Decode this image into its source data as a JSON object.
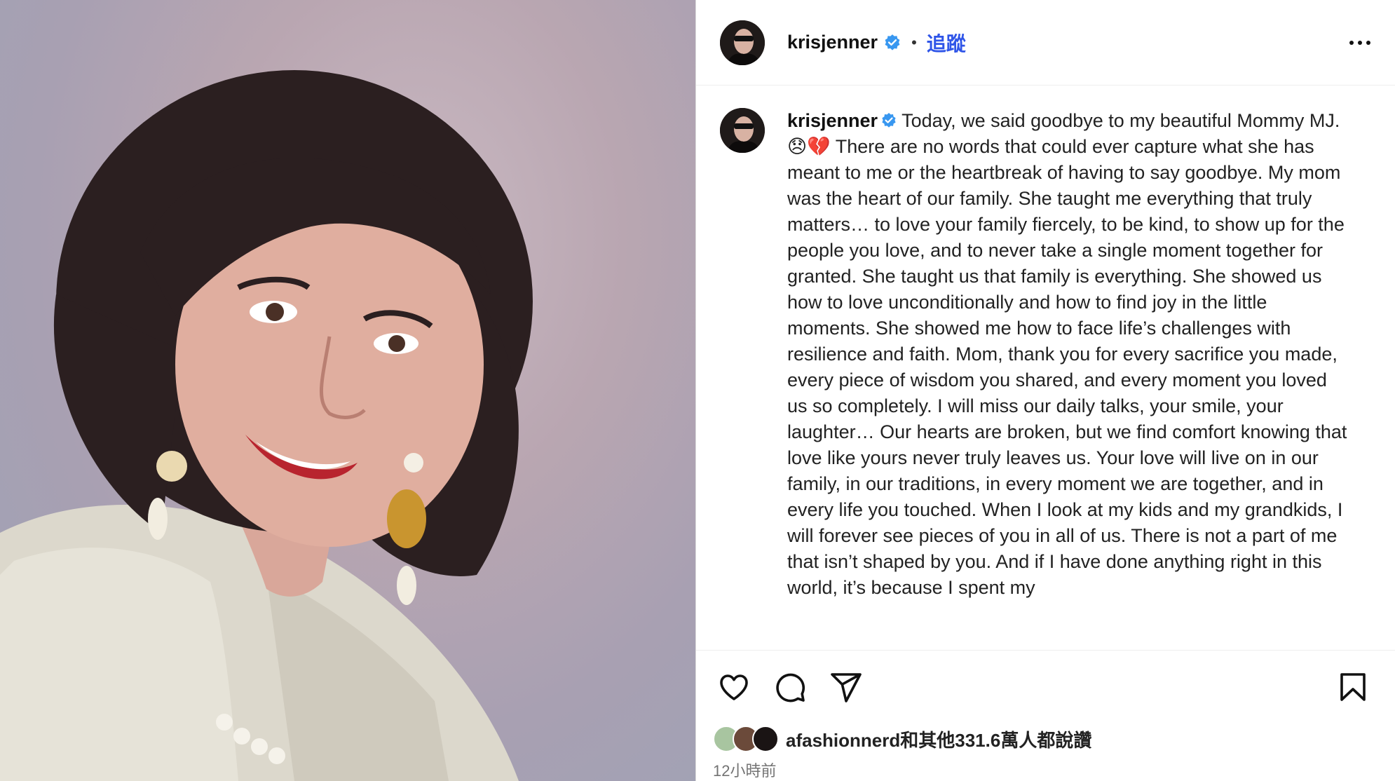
{
  "post": {
    "username": "krisjenner",
    "follow_label": "追蹤",
    "separator": "•",
    "caption": "Today, we said goodbye to my beautiful Mommy MJ. 😞💔 There are no words that could ever capture what she has meant to me or the heartbreak of having to say goodbye. My mom was the heart of our family. She taught me everything that truly matters… to love your family fiercely, to be kind, to show up for the people you love, and to never take a single moment together for granted. She taught us that family is everything. She showed us how to love unconditionally and how to find joy in the little moments. She showed me how to face life’s challenges with resilience and faith. Mom, thank you for every sacrifice you made, every piece of wisdom you shared, and every moment you loved us so completely. I will miss our daily talks, your smile, your laughter… Our hearts are broken, but we find comfort knowing that love like yours never truly leaves us. Your love will live on in our family, in our traditions, in every moment we are together, and in every life you touched. When I look at my kids and my grandkids, I will forever see pieces of you in all of us. There is not a part of me that isn’t shaped by you. And if I have done anything right in this world, it’s because I spent my",
    "likes_text": "afashionnerd和其他331.6萬人都說讚",
    "time_ago": "12小時前"
  },
  "colors": {
    "follow_blue": "#2f55e8",
    "verified_blue": "#3897f0"
  },
  "icons": [
    "heart-icon",
    "comment-icon",
    "share-icon",
    "bookmark-icon",
    "more-icon",
    "verified-badge-icon"
  ]
}
